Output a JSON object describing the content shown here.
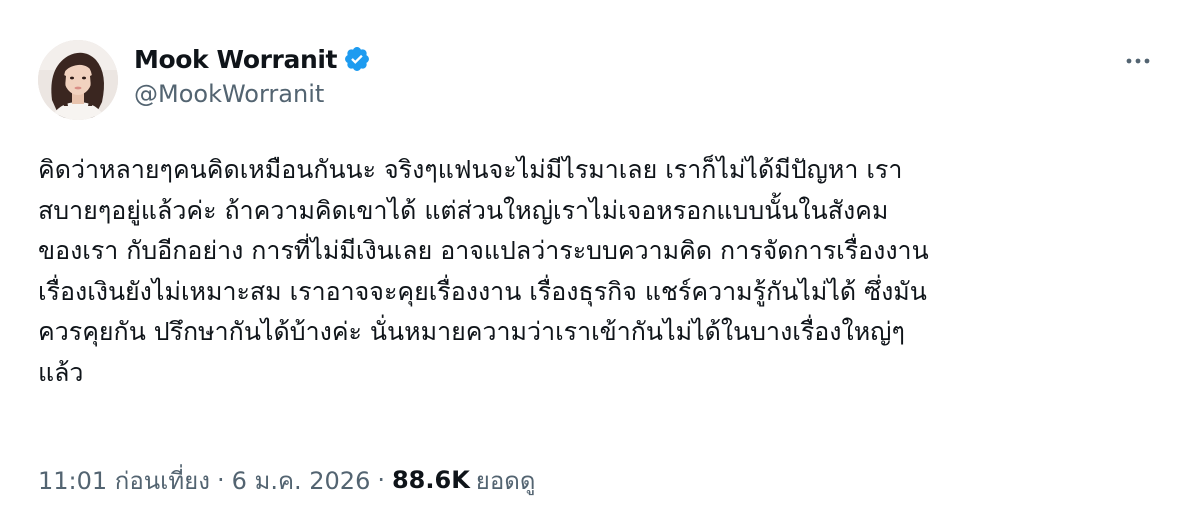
{
  "author": {
    "display_name": "Mook Worranit",
    "handle": "@MookWorranit",
    "verified": true,
    "verified_color": "#1d9bf0"
  },
  "tweet": {
    "lines": [
      "คิดว่าหลายๆคนคิดเหมือนกันนะ จริงๆแฟนจะไม่มีไรมาเลย เราก็ไม่ได้มีปัญหา เรา",
      "สบายๆอยู่แล้วค่ะ ถ้าความคิดเขาได้ แต่ส่วนใหญ่เราไม่เจอหรอกแบบนั้นในสังคม",
      "ของเรา กับอีกอย่าง การที่ไม่มีเงินเลย อาจแปลว่าระบบความคิด การจัดการเรื่องงาน",
      "เรื่องเงินยังไม่เหมาะสม เราอาจจะคุยเรื่องงาน เรื่องธุรกิจ แชร์ความรู้กันไม่ได้ ซึ่งมัน",
      "ควรคุยกัน ปรึกษากันได้บ้างค่ะ นั่นหมายความว่าเราเข้ากันไม่ได้ในบางเรื่องใหญ่ๆ",
      "แล้ว"
    ]
  },
  "meta": {
    "time": "11:01 ก่อนเที่ยง",
    "separator": "·",
    "date": "6 ม.ค. 2026",
    "views_count": "88.6K",
    "views_label": "ยอดดู"
  },
  "icons": {
    "verified": "verified-badge-icon",
    "more": "more-options-icon"
  }
}
